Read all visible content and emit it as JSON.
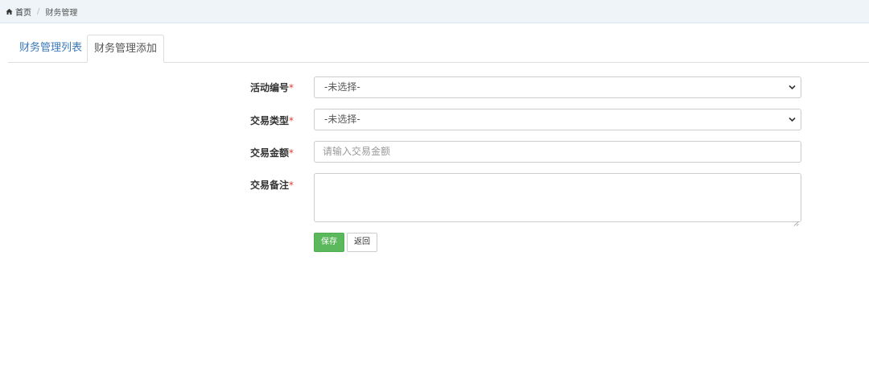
{
  "breadcrumb": {
    "home_label": "首页",
    "separator": "/",
    "current": "财务管理",
    "home_icon": "home-icon"
  },
  "tabs": [
    {
      "label": "财务管理列表",
      "active": false
    },
    {
      "label": "财务管理添加",
      "active": true
    }
  ],
  "form": {
    "required_mark": "*",
    "fields": [
      {
        "label": "活动编号",
        "type": "select",
        "value": "-未选择-"
      },
      {
        "label": "交易类型",
        "type": "select",
        "value": "-未选择-"
      },
      {
        "label": "交易金额",
        "type": "input",
        "placeholder": "请输入交易金额",
        "value": ""
      },
      {
        "label": "交易备注",
        "type": "textarea",
        "value": ""
      }
    ]
  },
  "buttons": {
    "save_label": "保存",
    "back_label": "返回"
  },
  "colors": {
    "accent_link": "#3a79b8",
    "save_green": "#5cb85c",
    "required_red": "#e23b3b",
    "breadcrumb_bg": "#eef4f8"
  }
}
